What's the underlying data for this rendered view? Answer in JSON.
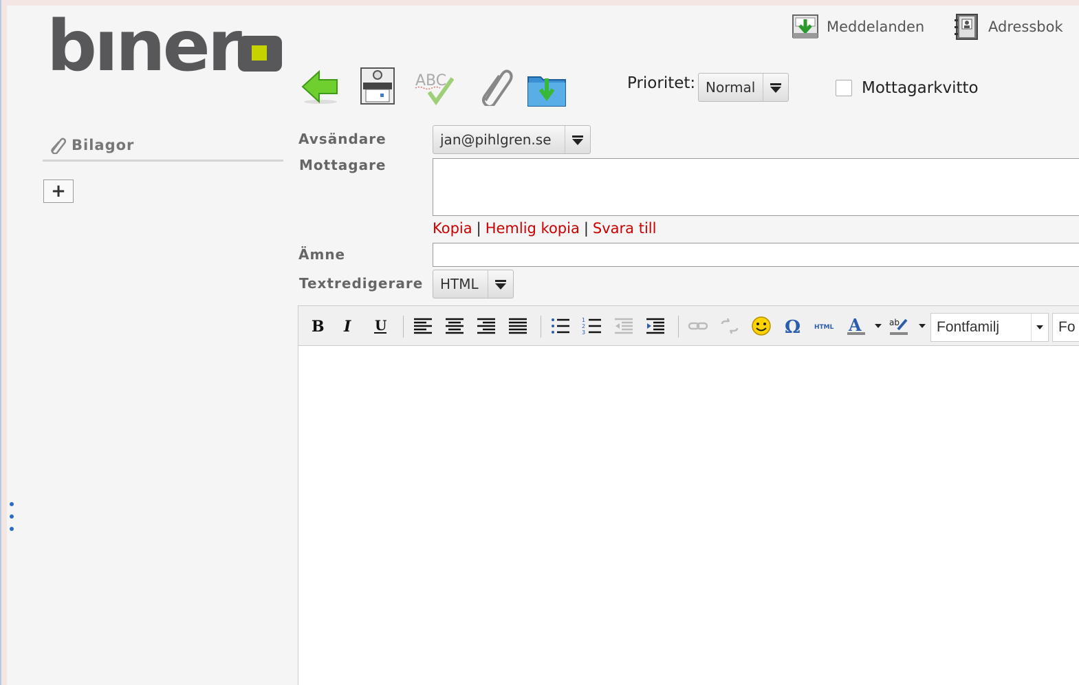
{
  "logo": {
    "text": "binero"
  },
  "topnav": {
    "messages": {
      "label": "Meddelanden",
      "icon": "inbox-download-icon"
    },
    "addressbook": {
      "label": "Adressbok",
      "icon": "address-book-icon"
    }
  },
  "toolbar": {
    "buttons": [
      {
        "name": "back",
        "icon": "back-arrow-icon"
      },
      {
        "name": "send",
        "icon": "send-mail-icon"
      },
      {
        "name": "spellcheck",
        "icon": "spellcheck-icon"
      },
      {
        "name": "attach",
        "icon": "paperclip-icon"
      },
      {
        "name": "save",
        "icon": "save-folder-icon"
      }
    ],
    "priority_label": "Prioritet:",
    "priority_value": "Normal",
    "receipt_label": "Mottagarkvitto",
    "receipt_checked": false
  },
  "sidebar": {
    "attachments_title": "Bilagor",
    "add_label": "+"
  },
  "form": {
    "sender_label": "Avsändare",
    "sender_value": "jan@pihlgren.se",
    "recipient_label": "Mottagare",
    "recipient_value": "",
    "cc_link": "Kopia",
    "bcc_link": "Hemlig kopia",
    "replyto_link": "Svara till",
    "link_separator": "|",
    "subject_label": "Ämne",
    "subject_value": "",
    "editor_label": "Textredigerare",
    "editor_value": "HTML"
  },
  "editor": {
    "font_family_placeholder": "Fontfamilj",
    "font_size_placeholder": "Fo",
    "body": ""
  },
  "colors": {
    "link": "#cc0000",
    "logo_dark": "#58585a",
    "logo_accent": "#c7d300",
    "background": "#f5f5f5"
  }
}
